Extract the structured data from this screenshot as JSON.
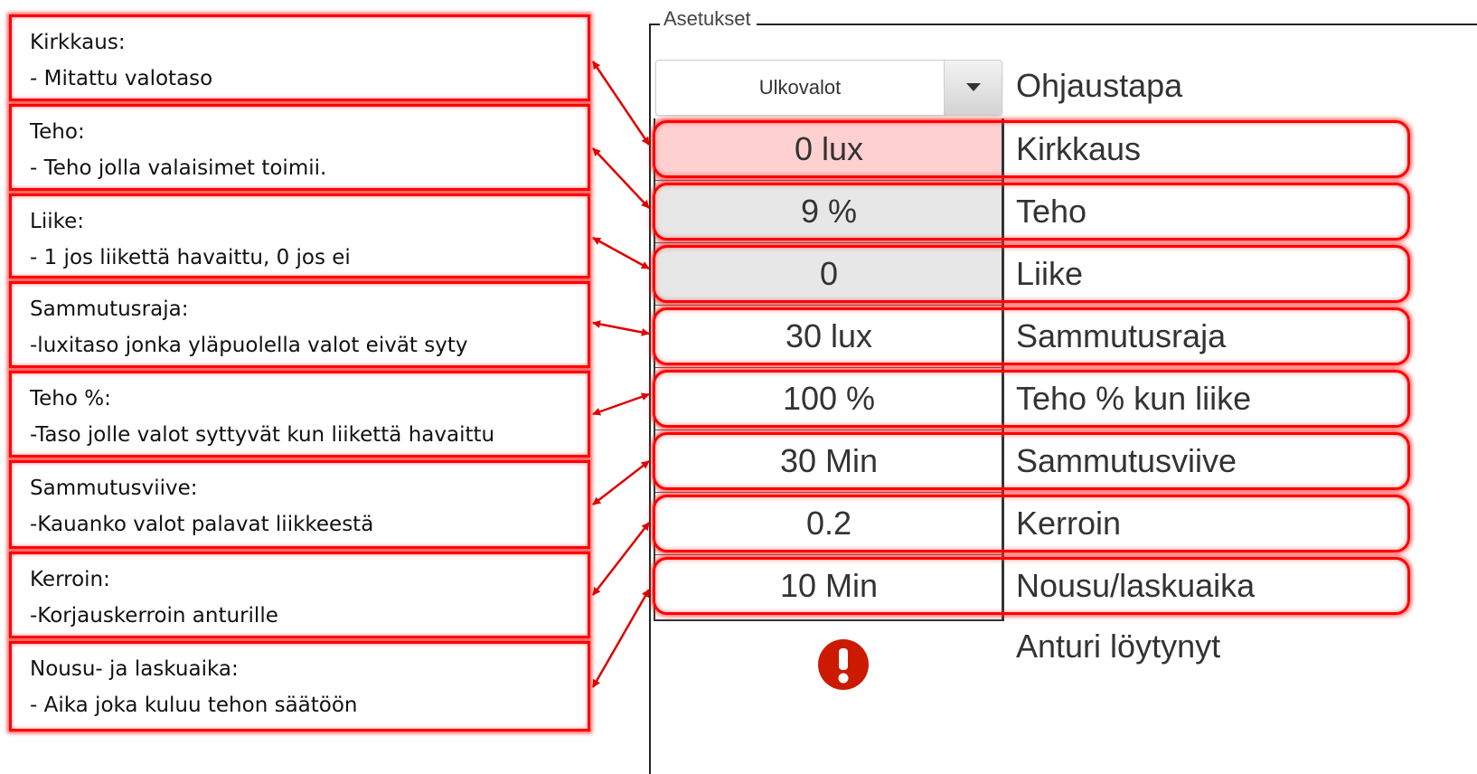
{
  "annotations": [
    {
      "title": "Kirkkaus:",
      "desc": "- Mitattu valotaso"
    },
    {
      "title": "Teho:",
      "desc": "- Teho jolla valaisimet toimii."
    },
    {
      "title": "Liike:",
      "desc": "- 1 jos liikettä havaittu, 0 jos ei"
    },
    {
      "title": "Sammutusraja:",
      "desc": "-luxitaso jonka yläpuolella valot eivät syty"
    },
    {
      "title": "Teho %:",
      "desc": "-Taso jolle valot syttyvät kun liikettä havaittu"
    },
    {
      "title": "Sammutusviive:",
      "desc": "-Kauanko valot palavat liikkeestä"
    },
    {
      "title": "Kerroin:",
      "desc": "-Korjauskerroin anturille"
    },
    {
      "title": "Nousu- ja laskuaika:",
      "desc": "- Aika joka kuluu tehon säätöön"
    }
  ],
  "settings": {
    "legend": "Asetukset",
    "mode": {
      "value": "Ulkovalot",
      "label": "Ohjaustapa"
    },
    "rows": [
      {
        "value": "0 lux",
        "label": "Kirkkaus"
      },
      {
        "value": "9 %",
        "label": "Teho"
      },
      {
        "value": "0",
        "label": "Liike"
      },
      {
        "value": "30 lux",
        "label": "Sammutusraja"
      },
      {
        "value": "100 %",
        "label": "Teho % kun liike"
      },
      {
        "value": "30 Min",
        "label": "Sammutusviive"
      },
      {
        "value": "0.2",
        "label": "Kerroin"
      },
      {
        "value": "10 Min",
        "label": "Nousu/laskuaika"
      }
    ],
    "sensor": {
      "label": "Anturi löytynyt",
      "icon": "alert-icon"
    }
  },
  "colors": {
    "highlight": "#ff0000",
    "alarm_fill": "#ffd0d0",
    "sensor_fill": "#e7e7e7",
    "alert_icon": "#cc1a00"
  }
}
